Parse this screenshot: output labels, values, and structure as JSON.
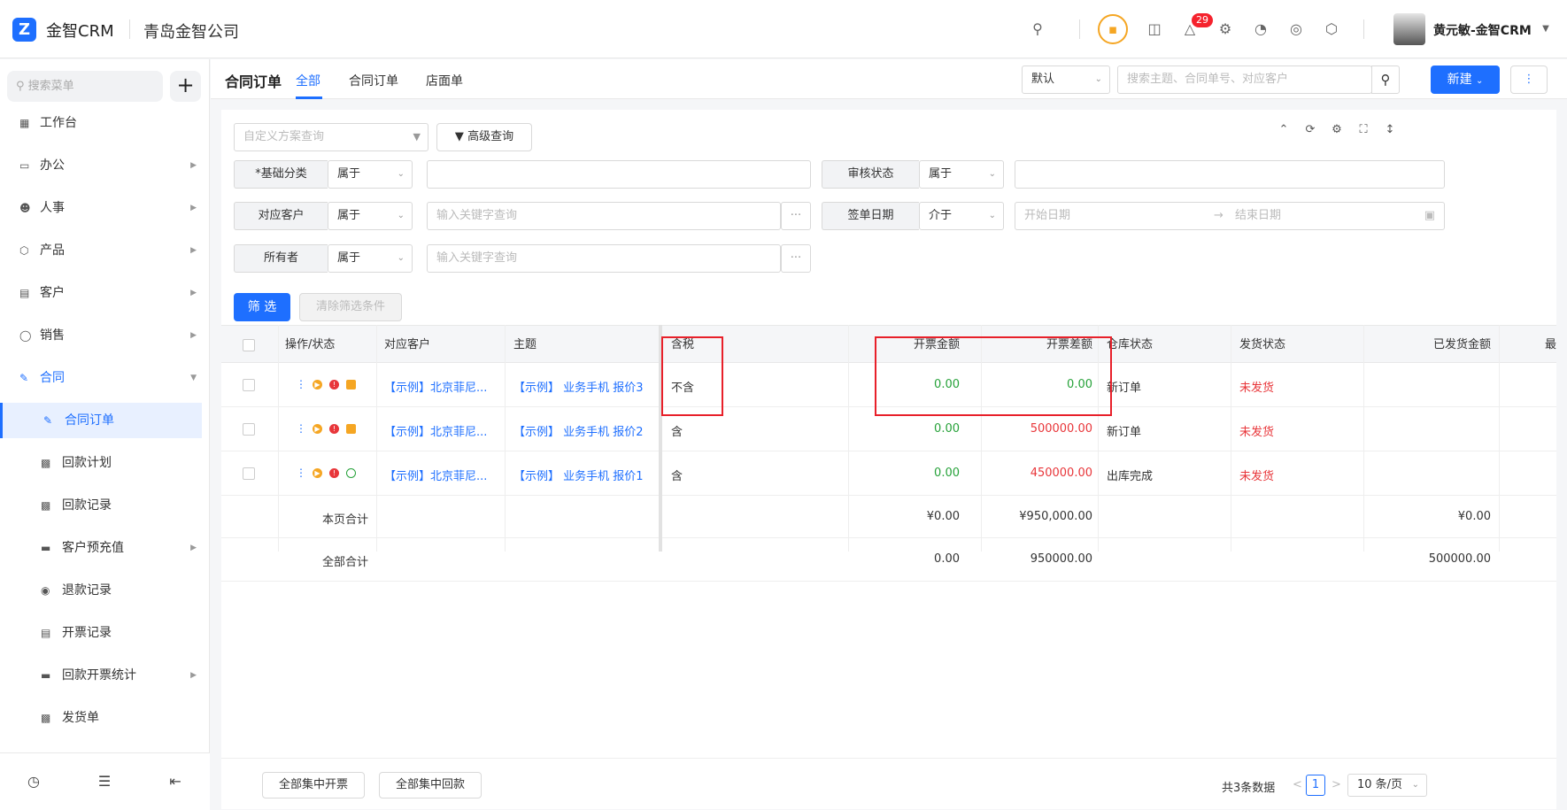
{
  "app": {
    "logo_letter": "Z",
    "brand": "金智CRM",
    "company": "青岛金智公司",
    "notification_count": "29",
    "user": "黄元敏-金智CRM"
  },
  "sidebar": {
    "search_placeholder": "搜索菜单",
    "add": "+",
    "items": [
      {
        "label": "工作台",
        "icon": "dashboard-icon"
      },
      {
        "label": "办公",
        "icon": "monitor-icon",
        "arrow": "▶"
      },
      {
        "label": "人事",
        "icon": "people-icon",
        "arrow": "▶"
      },
      {
        "label": "产品",
        "icon": "box-icon",
        "arrow": "▶"
      },
      {
        "label": "客户",
        "icon": "building-icon",
        "arrow": "▶"
      },
      {
        "label": "销售",
        "icon": "sales-icon",
        "arrow": "▶"
      },
      {
        "label": "合同",
        "icon": "contract-icon",
        "arrow": "▼"
      }
    ],
    "subitems": [
      {
        "label": "合同订单"
      },
      {
        "label": "回款计划"
      },
      {
        "label": "回款记录"
      },
      {
        "label": "客户预充值",
        "arrow": "▶"
      },
      {
        "label": "退款记录"
      },
      {
        "label": "开票记录"
      },
      {
        "label": "回款开票统计",
        "arrow": "▶"
      },
      {
        "label": "发货单"
      }
    ]
  },
  "header": {
    "title": "合同订单",
    "tabs": [
      "全部",
      "合同订单",
      "店面单"
    ],
    "sort_value": "默认",
    "search_placeholder": "搜索主题、合同单号、对应客户",
    "new_button": "新建",
    "more": "⋮"
  },
  "filters": {
    "scheme_placeholder": "自定义方案查询",
    "advanced": "高级查询",
    "rows": [
      {
        "label": "*基础分类",
        "op": "属于"
      },
      {
        "label": "审核状态",
        "op": "属于"
      },
      {
        "label": "对应客户",
        "op": "属于",
        "placeholder": "输入关键字查询"
      },
      {
        "label": "签单日期",
        "op": "介于",
        "start": "开始日期",
        "arrow": "→",
        "end": "结束日期"
      },
      {
        "label": "所有者",
        "op": "属于",
        "placeholder": "输入关键字查询"
      }
    ],
    "more_dots": "···",
    "filter_button": "筛 选",
    "clear_button": "清除筛选条件"
  },
  "table": {
    "columns": [
      "操作/状态",
      "对应客户",
      "主题",
      "含税",
      "开票金额",
      "开票差额",
      "仓库状态",
      "发货状态",
      "已发货金额",
      "最"
    ],
    "rows": [
      {
        "customer": "【示例】北京菲尼...",
        "subject": "【示例】 业务手机 报价3",
        "tax": "不含",
        "invoice": "0.00",
        "diff": "0.00",
        "warehouse": "新订单",
        "ship": "未发货",
        "shipped": ""
      },
      {
        "customer": "【示例】北京菲尼...",
        "subject": "【示例】 业务手机 报价2",
        "tax": "含",
        "invoice": "0.00",
        "diff": "500000.00",
        "warehouse": "新订单",
        "ship": "未发货",
        "shipped": ""
      },
      {
        "customer": "【示例】北京菲尼...",
        "subject": "【示例】 业务手机 报价1",
        "tax": "含",
        "invoice": "0.00",
        "diff": "450000.00",
        "warehouse": "出库完成",
        "ship": "未发货",
        "shipped": ""
      }
    ],
    "page_total": {
      "label": "本页合计",
      "invoice": "¥0.00",
      "diff": "¥950,000.00",
      "shipped": "¥0.00"
    },
    "all_total": {
      "label": "全部合计",
      "invoice": "0.00",
      "diff": "950000.00",
      "shipped": "500000.00"
    },
    "action_glyphs": {
      "more": "⋮",
      "play": "▶",
      "alert": "!"
    }
  },
  "footer": {
    "btn_invoice": "全部集中开票",
    "btn_payment": "全部集中回款",
    "total": "共3条数据",
    "prev": "<",
    "page": "1",
    "next": ">",
    "page_size": "10 条/页"
  }
}
